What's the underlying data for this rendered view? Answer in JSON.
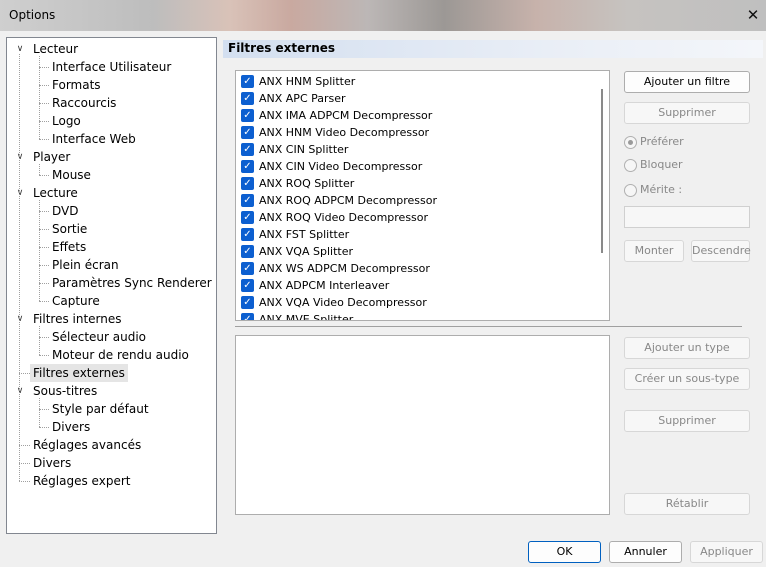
{
  "window": {
    "title": "Options",
    "close_glyph": "✕",
    "close_icon": "close-icon"
  },
  "tree": {
    "items": [
      {
        "label": "Lecteur",
        "level": 0,
        "expandable": true
      },
      {
        "label": "Interface Utilisateur",
        "level": 1
      },
      {
        "label": "Formats",
        "level": 1
      },
      {
        "label": "Raccourcis",
        "level": 1
      },
      {
        "label": "Logo",
        "level": 1
      },
      {
        "label": "Interface Web",
        "level": 1
      },
      {
        "label": "Player",
        "level": 0,
        "expandable": true
      },
      {
        "label": "Mouse",
        "level": 1
      },
      {
        "label": "Lecture",
        "level": 0,
        "expandable": true
      },
      {
        "label": "DVD",
        "level": 1
      },
      {
        "label": "Sortie",
        "level": 1
      },
      {
        "label": "Effets",
        "level": 1
      },
      {
        "label": "Plein écran",
        "level": 1
      },
      {
        "label": "Paramètres Sync Renderer",
        "level": 1
      },
      {
        "label": "Capture",
        "level": 1
      },
      {
        "label": "Filtres internes",
        "level": 0,
        "expandable": true
      },
      {
        "label": "Sélecteur audio",
        "level": 1
      },
      {
        "label": "Moteur de rendu audio",
        "level": 1
      },
      {
        "label": "Filtres externes",
        "level": 0,
        "selected": true
      },
      {
        "label": "Sous-titres",
        "level": 0,
        "expandable": true
      },
      {
        "label": "Style par défaut",
        "level": 1
      },
      {
        "label": "Divers",
        "level": 1
      },
      {
        "label": "Réglages avancés",
        "level": 0
      },
      {
        "label": "Divers",
        "level": 0
      },
      {
        "label": "Réglages expert",
        "level": 0
      }
    ],
    "expand_glyph": "∨"
  },
  "panel": {
    "header": "Filtres externes",
    "filters": [
      "ANX HNM Splitter",
      "ANX APC Parser",
      "ANX IMA ADPCM Decompressor",
      "ANX HNM Video Decompressor",
      "ANX CIN Splitter",
      "ANX CIN Video Decompressor",
      "ANX ROQ Splitter",
      "ANX ROQ ADPCM Decompressor",
      "ANX ROQ Video Decompressor",
      "ANX FST Splitter",
      "ANX VQA Splitter",
      "ANX WS ADPCM Decompressor",
      "ANX ADPCM Interleaver",
      "ANX VQA Video Decompressor",
      "ANX MVE Splitter"
    ],
    "check_glyph": "✓",
    "buttons": {
      "add_filter": "Ajouter un filtre",
      "remove": "Supprimer",
      "move_up": "Monter",
      "move_down": "Descendre",
      "add_type": "Ajouter un type",
      "create_subtype": "Créer un sous-type",
      "remove_type": "Supprimer",
      "reset": "Rétablir"
    },
    "radios": {
      "prefer": "Préférer",
      "block": "Bloquer",
      "merit": "Mérite :"
    }
  },
  "footer": {
    "ok": "OK",
    "cancel": "Annuler",
    "apply": "Appliquer"
  }
}
